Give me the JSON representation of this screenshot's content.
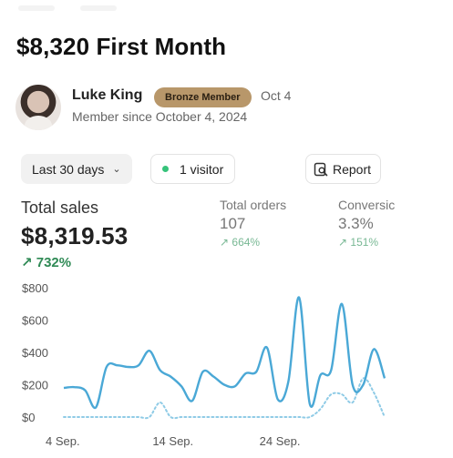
{
  "page": {
    "title": "$8,320 First Month"
  },
  "profile": {
    "name": "Luke King",
    "badge": "Bronze Member",
    "date": "Oct 4",
    "member_since": "Member since October 4, 2024"
  },
  "controls": {
    "range_label": "Last 30 days",
    "visitor_label": "1 visitor",
    "report_label": "Report"
  },
  "metrics": {
    "total_sales": {
      "label": "Total sales",
      "value": "$8,319.53",
      "change": "732%"
    },
    "total_orders": {
      "label": "Total orders",
      "value": "107",
      "change": "664%"
    },
    "conversion": {
      "label": "Conversic",
      "value": "3.3%",
      "change": "151%"
    }
  },
  "colors": {
    "primary_line": "#4aa8d6",
    "secondary_line": "#8fcbe6",
    "badge": "#b8976a",
    "positive": "#2f8a55",
    "visitor_dot": "#36c37a"
  },
  "chart_data": {
    "type": "line",
    "ylim": [
      0,
      800
    ],
    "ytick_labels": [
      "$0",
      "$200",
      "$400",
      "$600",
      "$800"
    ],
    "yticks": [
      0,
      200,
      400,
      600,
      800
    ],
    "xtick_labels": [
      "4 Sep.",
      "14 Sep.",
      "24 Sep."
    ],
    "xticks": [
      0,
      10,
      20
    ],
    "series": [
      {
        "style": "solid",
        "values": [
          180,
          185,
          165,
          60,
          310,
          320,
          310,
          320,
          410,
          290,
          250,
          190,
          100,
          280,
          250,
          200,
          190,
          270,
          280,
          430,
          110,
          220,
          740,
          80,
          260,
          290,
          700,
          200,
          200,
          420,
          240
        ]
      },
      {
        "style": "dotted",
        "values": [
          0,
          0,
          0,
          0,
          0,
          0,
          0,
          0,
          0,
          90,
          0,
          0,
          0,
          0,
          0,
          0,
          0,
          0,
          0,
          0,
          0,
          0,
          0,
          0,
          50,
          140,
          140,
          90,
          240,
          150,
          0
        ]
      }
    ]
  }
}
